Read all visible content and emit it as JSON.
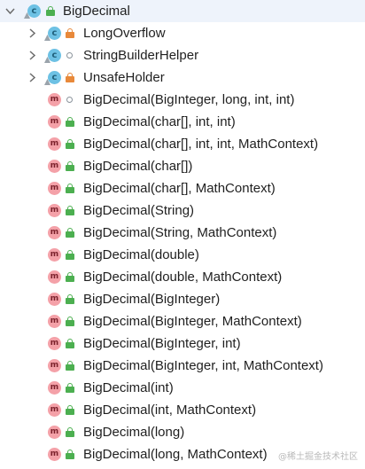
{
  "tree": {
    "root": {
      "label": "BigDecimal",
      "icon": "class-icon",
      "access": "public-icon",
      "expanded": true
    },
    "children": [
      {
        "label": "LongOverflow",
        "icon": "class-icon",
        "access": "private-icon",
        "collapsed": true
      },
      {
        "label": "StringBuilderHelper",
        "icon": "class-icon",
        "access": "package-private-icon",
        "collapsed": true
      },
      {
        "label": "UnsafeHolder",
        "icon": "class-icon",
        "access": "private-icon",
        "collapsed": true
      },
      {
        "label": "BigDecimal(BigInteger, long, int, int)",
        "icon": "method-icon",
        "access": "package-private-icon"
      },
      {
        "label": "BigDecimal(char[], int, int)",
        "icon": "method-icon",
        "access": "public-icon"
      },
      {
        "label": "BigDecimal(char[], int, int, MathContext)",
        "icon": "method-icon",
        "access": "public-icon"
      },
      {
        "label": "BigDecimal(char[])",
        "icon": "method-icon",
        "access": "public-icon"
      },
      {
        "label": "BigDecimal(char[], MathContext)",
        "icon": "method-icon",
        "access": "public-icon"
      },
      {
        "label": "BigDecimal(String)",
        "icon": "method-icon",
        "access": "public-icon"
      },
      {
        "label": "BigDecimal(String, MathContext)",
        "icon": "method-icon",
        "access": "public-icon"
      },
      {
        "label": "BigDecimal(double)",
        "icon": "method-icon",
        "access": "public-icon"
      },
      {
        "label": "BigDecimal(double, MathContext)",
        "icon": "method-icon",
        "access": "public-icon"
      },
      {
        "label": "BigDecimal(BigInteger)",
        "icon": "method-icon",
        "access": "public-icon"
      },
      {
        "label": "BigDecimal(BigInteger, MathContext)",
        "icon": "method-icon",
        "access": "public-icon"
      },
      {
        "label": "BigDecimal(BigInteger, int)",
        "icon": "method-icon",
        "access": "public-icon"
      },
      {
        "label": "BigDecimal(BigInteger, int, MathContext)",
        "icon": "method-icon",
        "access": "public-icon"
      },
      {
        "label": "BigDecimal(int)",
        "icon": "method-icon",
        "access": "public-icon"
      },
      {
        "label": "BigDecimal(int, MathContext)",
        "icon": "method-icon",
        "access": "public-icon"
      },
      {
        "label": "BigDecimal(long)",
        "icon": "method-icon",
        "access": "public-icon"
      },
      {
        "label": "BigDecimal(long, MathContext)",
        "icon": "method-icon",
        "access": "public-icon"
      }
    ]
  },
  "watermark": "@稀土掘金技术社区",
  "colors": {
    "class_icon_bg": "#6dc1e4",
    "method_icon_bg": "#f4a1a8",
    "public_lock": "#4caf50",
    "private_lock": "#e8893a",
    "package_circle": "#8a939b"
  }
}
